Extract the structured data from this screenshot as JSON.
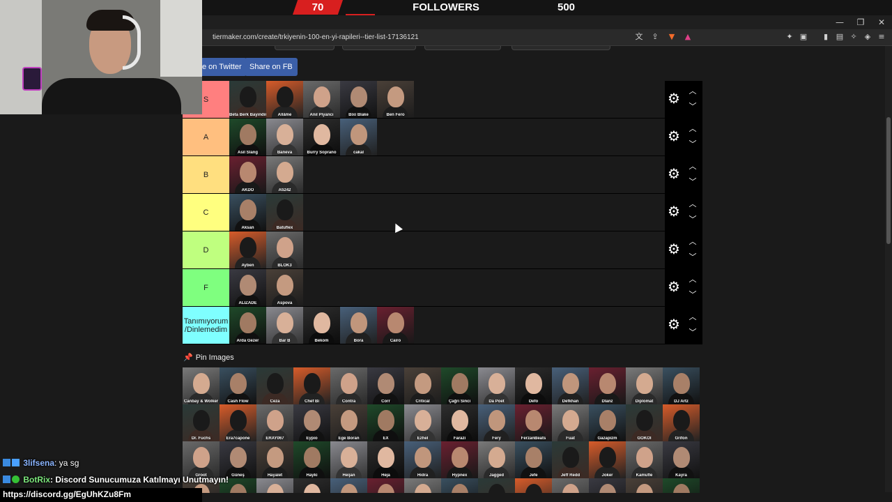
{
  "followers": {
    "current": "70",
    "label": "FOLLOWERS",
    "goal": "500",
    "progress_fraction": 0.14,
    "accent": "#d81f1f"
  },
  "browser": {
    "url": "tiermaker.com/create/trkiyenin-100-en-yi-rapileri--tier-list-17136121",
    "window_buttons": [
      "minimize-icon",
      "restore-icon",
      "close-icon"
    ],
    "toolbar_icons": [
      "translate-icon",
      "share-icon",
      "brave-shield-icon",
      "rewards-icon",
      "extensions-icon",
      "screenshot-icon",
      "sidebar-icon",
      "wallet-icon",
      "leo-icon",
      "vpn-icon",
      "menu-icon"
    ]
  },
  "share": {
    "twitter": "e on Twitter",
    "facebook": "Share on FB"
  },
  "tiers": [
    {
      "label": "S",
      "color": "#ff7f7f",
      "items": [
        "Beta Berk Bayındır",
        "Allâme",
        "Anıl Piyancı",
        "Bixi Blake",
        "Ben Fero"
      ]
    },
    {
      "label": "A",
      "color": "#ffbf7f",
      "items": [
        "Asil Slang",
        "Baneva",
        "Burry Soprano",
        "cakal"
      ]
    },
    {
      "label": "B",
      "color": "#ffdf7f",
      "items": [
        "AKDO",
        "Ati242"
      ]
    },
    {
      "label": "C",
      "color": "#ffff7f",
      "items": [
        "Aksan",
        "Batuflex"
      ]
    },
    {
      "label": "D",
      "color": "#bfff7f",
      "items": [
        "Ayben",
        "BLOK3"
      ]
    },
    {
      "label": "F",
      "color": "#7fff7f",
      "items": [
        "ALIZADE",
        "Aspova"
      ]
    },
    {
      "label": "Tanımıyorum /Dinlemedim",
      "color": "#7fffff",
      "items": [
        "Arda Gezer",
        "Bar B",
        "Bekom",
        "Bora",
        "Cairo"
      ]
    }
  ],
  "pool": {
    "title": "Pin Images",
    "rows": [
      [
        "Canbay & Wolker",
        "Cash Flow",
        "Ceza",
        "Chef Bi",
        "Contra",
        "Corr",
        "Critical",
        "Çağrı Sinci",
        "Da Poet",
        "Defo",
        "Defkhan",
        "Dlanz",
        "Diplomat",
        "DJ Artz"
      ],
      [
        "Dr. Fuchs",
        "Era7capone",
        "ERAY067",
        "Eypio",
        "Ege Boran",
        "EX",
        "Ezhel",
        "Farazi",
        "Fery",
        "FerzanBeats",
        "Fuat",
        "Gazapizm",
        "GOKOI",
        "Grifon"
      ],
      [
        "Groot",
        "Güneş",
        "Hayalet",
        "Hayki",
        "Heijan",
        "Heja",
        "Hidra",
        "Hypnex",
        "Jagged",
        "Jefe",
        "Jeff Redd",
        "Joker",
        "Kamufle",
        "Kayra"
      ]
    ]
  },
  "chat": [
    {
      "user": "3lifsena",
      "text": ": ya sg"
    },
    {
      "user": "BotRix",
      "text": ": Discord Sunucumuza Katılmayı Unutmayın!"
    }
  ],
  "chat_link": "https://discord.gg/EgUhKZu8Fm"
}
